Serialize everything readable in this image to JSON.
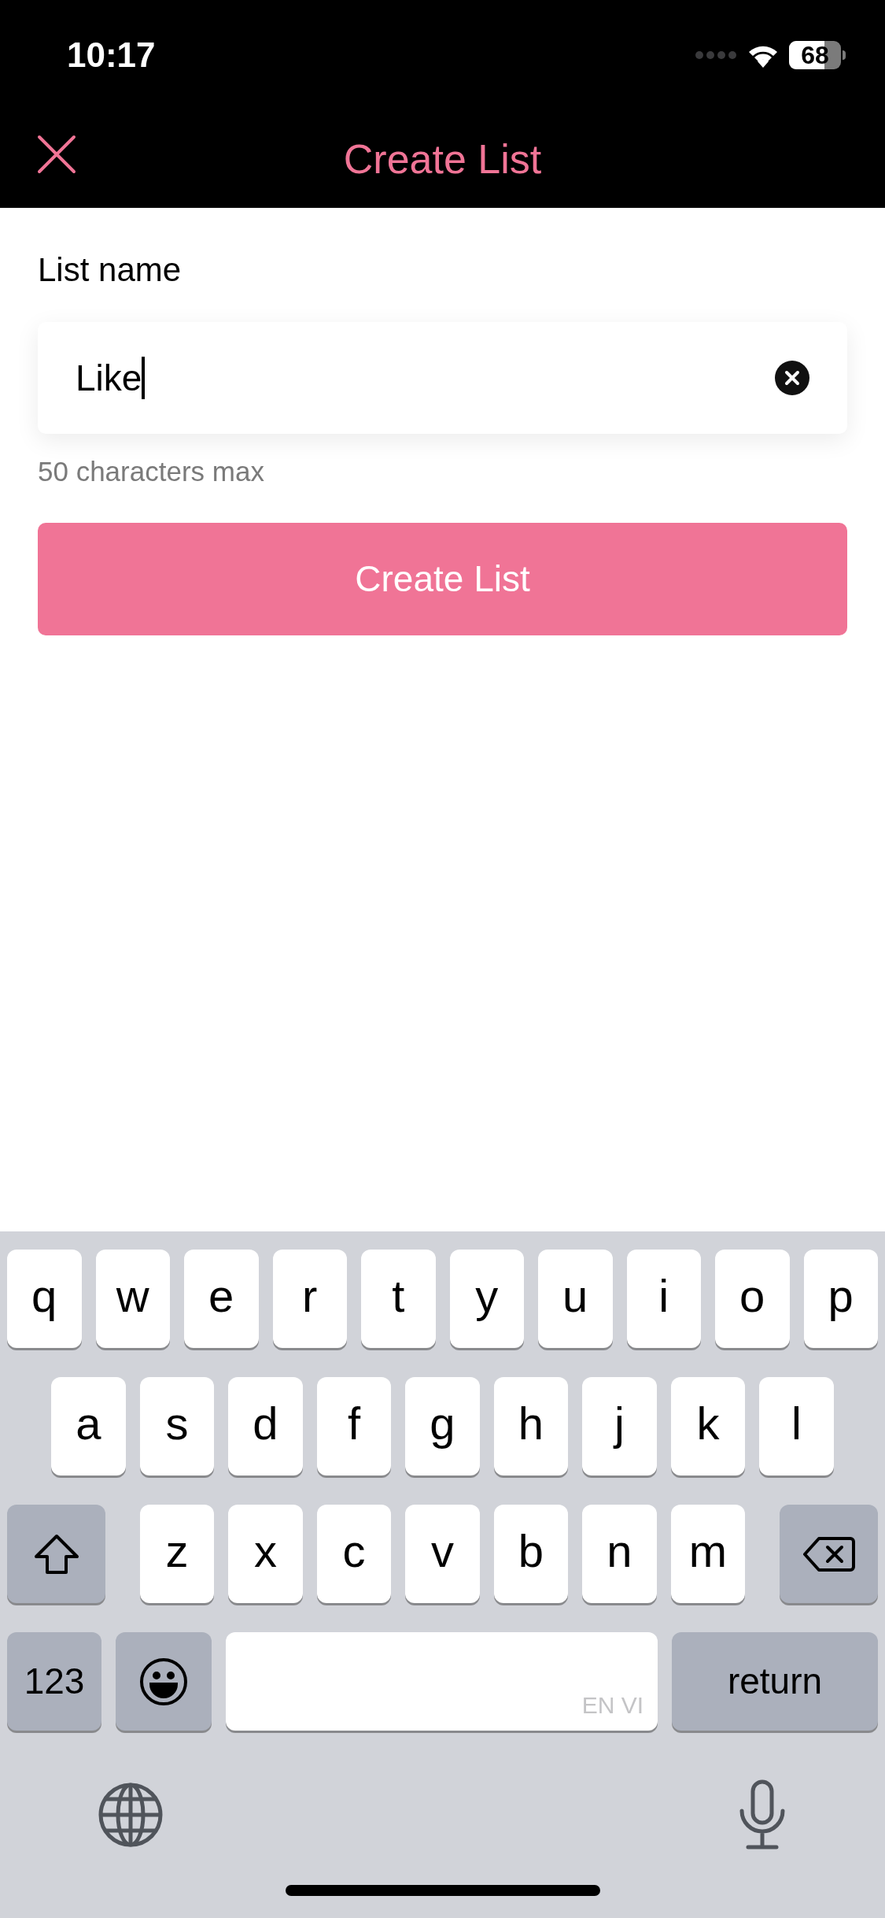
{
  "status_bar": {
    "time": "10:17",
    "battery": "68"
  },
  "header": {
    "title": "Create List"
  },
  "form": {
    "label": "List name",
    "field": {
      "value": "Like",
      "focused": true
    },
    "helper": "50 characters max",
    "button": "Create List"
  },
  "keyboard": {
    "rows": [
      {
        "keys": [
          {
            "kind": "letter",
            "label": "q"
          },
          {
            "kind": "letter",
            "label": "w"
          },
          {
            "kind": "letter",
            "label": "e"
          },
          {
            "kind": "letter",
            "label": "r"
          },
          {
            "kind": "letter",
            "label": "t"
          },
          {
            "kind": "letter",
            "label": "y"
          },
          {
            "kind": "letter",
            "label": "u"
          },
          {
            "kind": "letter",
            "label": "i"
          },
          {
            "kind": "letter",
            "label": "o"
          },
          {
            "kind": "letter",
            "label": "p"
          }
        ]
      },
      {
        "keys": [
          {
            "kind": "letter",
            "label": "a"
          },
          {
            "kind": "letter",
            "label": "s"
          },
          {
            "kind": "letter",
            "label": "d"
          },
          {
            "kind": "letter",
            "label": "f"
          },
          {
            "kind": "letter",
            "label": "g"
          },
          {
            "kind": "letter",
            "label": "h"
          },
          {
            "kind": "letter",
            "label": "j"
          },
          {
            "kind": "letter",
            "label": "k"
          },
          {
            "kind": "letter",
            "label": "l"
          }
        ]
      },
      {
        "keys": [
          {
            "kind": "shift"
          },
          {
            "kind": "letter",
            "label": "z"
          },
          {
            "kind": "letter",
            "label": "x"
          },
          {
            "kind": "letter",
            "label": "c"
          },
          {
            "kind": "letter",
            "label": "v"
          },
          {
            "kind": "letter",
            "label": "b"
          },
          {
            "kind": "letter",
            "label": "n"
          },
          {
            "kind": "letter",
            "label": "m"
          },
          {
            "kind": "delete"
          }
        ]
      },
      {
        "keys": [
          {
            "kind": "numbers",
            "label": "123"
          },
          {
            "kind": "emoji"
          },
          {
            "kind": "space",
            "label": "EN VI"
          },
          {
            "kind": "return",
            "label": "return"
          }
        ]
      }
    ]
  }
}
